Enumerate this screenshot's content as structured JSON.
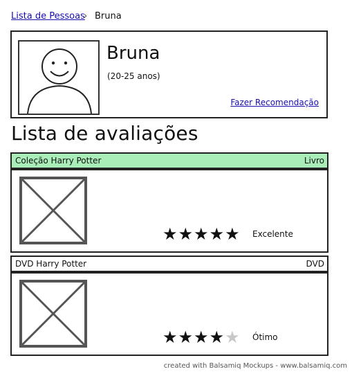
{
  "breadcrumb": {
    "parent": "Lista de Pessoas",
    "separator": "›",
    "current": "Bruna"
  },
  "profile": {
    "name": "Bruna",
    "age": "(20-25 anos)",
    "recommend_link": "Fazer Recomendação"
  },
  "section_title": "Lista de avaliações",
  "ratings": [
    {
      "title": "Coleção Harry Potter",
      "type": "Livro",
      "stars": 5,
      "max_stars": 5,
      "label": "Excelente",
      "highlight_color": "#a9eeb9"
    },
    {
      "title": "DVD Harry Potter",
      "type": "DVD",
      "stars": 4,
      "max_stars": 5,
      "label": "Ótimo"
    }
  ],
  "footer": "created with Balsamiq Mockups - www.balsamiq.com"
}
